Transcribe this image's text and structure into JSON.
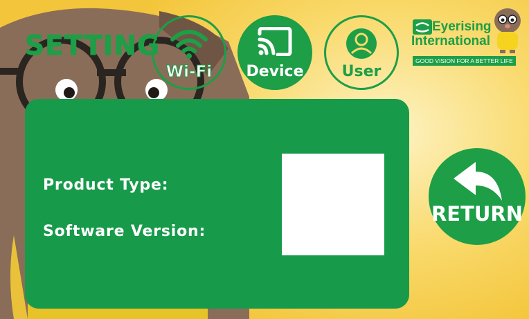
{
  "header": {
    "title": "SETTING",
    "nav": [
      {
        "id": "wifi",
        "label": "Wi-Fi",
        "icon": "wifi-icon"
      },
      {
        "id": "device",
        "label": "Device",
        "icon": "cast-icon",
        "active": true
      },
      {
        "id": "user",
        "label": "User",
        "icon": "user-icon"
      }
    ]
  },
  "logo": {
    "brand_line1": "Eyerising",
    "brand_line2": "International",
    "tagline": "GOOD VISION FOR A BETTER LIFE"
  },
  "panel": {
    "product_type_label": "Product Type:",
    "software_version_label": "Software Version:"
  },
  "return_button": {
    "label": "RETURN",
    "icon": "return-arrow-icon"
  },
  "colors": {
    "accent": "#1d9e47",
    "panel": "#179a4a",
    "background": "#f9d96a"
  }
}
